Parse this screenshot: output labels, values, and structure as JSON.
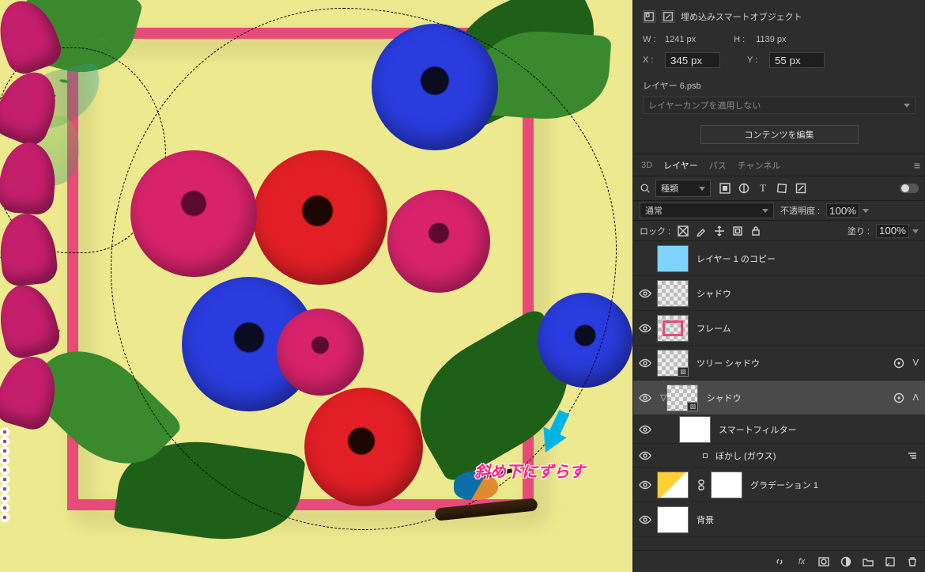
{
  "properties": {
    "title": "埋め込みスマートオブジェクト",
    "w_label": "W :",
    "w_value": "1241 px",
    "h_label": "H :",
    "h_value": "1139 px",
    "x_label": "X :",
    "x_value": "345 px",
    "y_label": "Y :",
    "y_value": "55 px",
    "file": "レイヤー 6.psb",
    "layercomp_placeholder": "レイヤーカンプを適用しない",
    "edit_contents": "コンテンツを編集"
  },
  "panels": {
    "tabs": [
      "3D",
      "レイヤー",
      "パス",
      "チャンネル"
    ],
    "active": 1,
    "filter_kind": "種類",
    "blend_mode": "通常",
    "opacity_label": "不透明度 :",
    "opacity_value": "100%",
    "lock_label": "ロック :",
    "fill_label": "塗り :",
    "fill_value": "100%"
  },
  "layers": [
    {
      "name": "レイヤー 1 のコピー",
      "thumb": "sky",
      "visible": false,
      "indent": 0
    },
    {
      "name": "シャドウ",
      "thumb": "transparent",
      "visible": true,
      "indent": 0
    },
    {
      "name": "フレーム",
      "thumb": "frame",
      "visible": true,
      "indent": 0
    },
    {
      "name": "ツリー シャドウ",
      "thumb": "transparent",
      "visible": true,
      "indent": 0,
      "smartObject": true,
      "advanced": true
    },
    {
      "name": "シャドウ",
      "thumb": "transparent",
      "visible": true,
      "indent": 0,
      "smartObject": true,
      "advanced": true,
      "selected": true,
      "expanded": true
    },
    {
      "name": "スマートフィルター",
      "thumb": "white",
      "visible": true,
      "indent": 1,
      "short": true
    },
    {
      "name": "ぼかし (ガウス)",
      "filterRow": true,
      "visible": true
    },
    {
      "name": "グラデーション 1",
      "thumb": "grad",
      "visible": true,
      "indent": 0,
      "linkedMask": true
    },
    {
      "name": "背景",
      "thumb": "white",
      "visible": true,
      "indent": 0
    }
  ],
  "canvas": {
    "annotation": "斜め下にずらす"
  }
}
